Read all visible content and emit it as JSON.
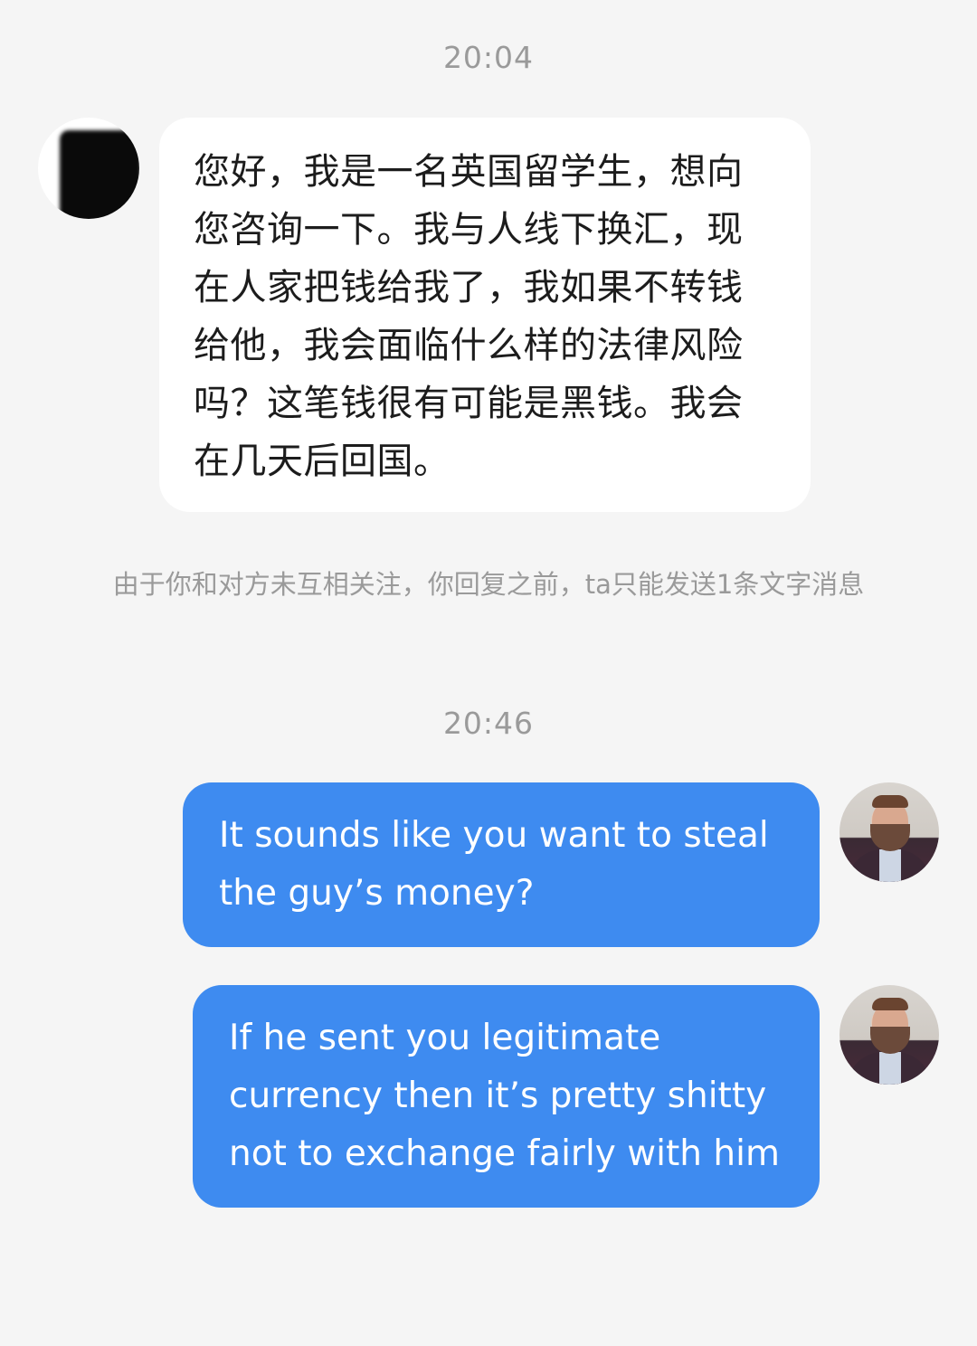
{
  "chat": {
    "timestamp_1": "20:04",
    "incoming_message": "您好，我是一名英国留学生，想向您咨询一下。我与人线下换汇，现在人家把钱给我了，我如果不转钱给他，我会面临什么样的法律风险吗？这笔钱很有可能是黑钱。我会在几天后回国。",
    "notice": "由于你和对方未互相关注，你回复之前，ta只能发送1条文字消息",
    "timestamp_2": "20:46",
    "outgoing_1": "It sounds like you want to steal the guy’s money?",
    "outgoing_2": "If he sent you legitimate currency then it’s pretty shitty not to exchange fairly with him"
  },
  "colors": {
    "background": "#f5f5f5",
    "incoming_bubble": "#ffffff",
    "outgoing_bubble": "#3e8bf0",
    "timestamp_text": "#9a9a9a"
  }
}
